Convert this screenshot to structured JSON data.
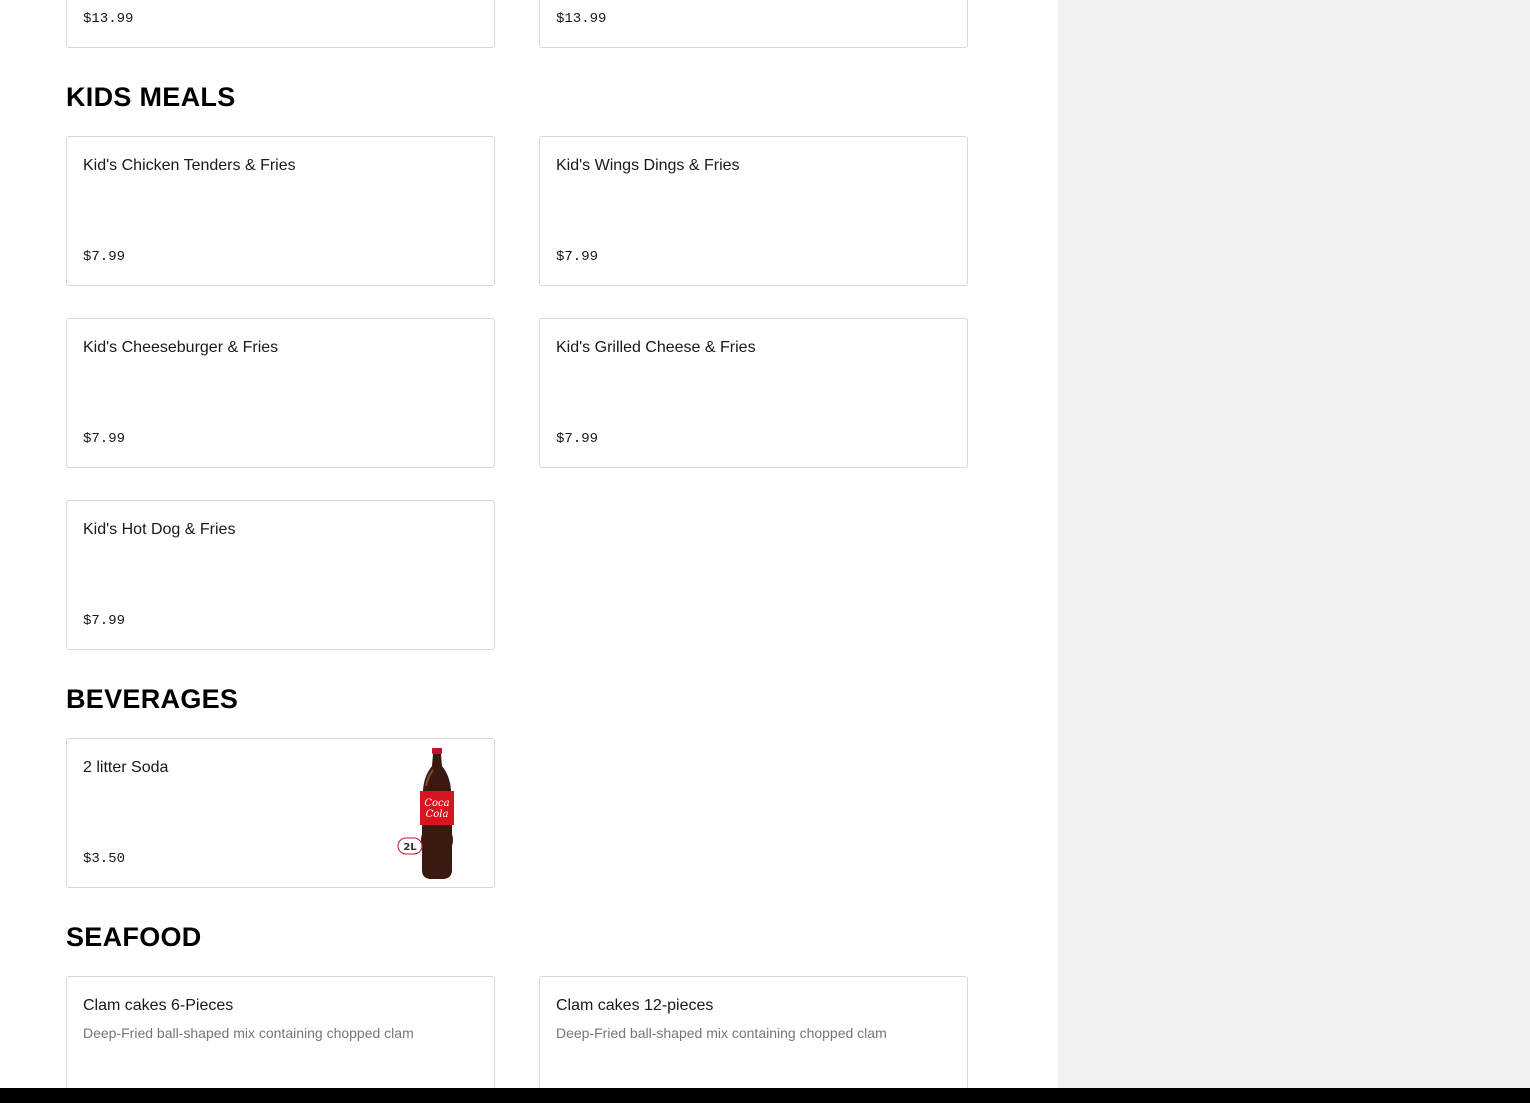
{
  "top_cards": [
    {
      "price": "$13.99"
    },
    {
      "price": "$13.99"
    }
  ],
  "sections": {
    "kids_meals": {
      "title": "KIDS MEALS",
      "items": [
        {
          "name": "Kid's Chicken Tenders & Fries",
          "price": "$7.99"
        },
        {
          "name": "Kid's Wings Dings & Fries",
          "price": "$7.99"
        },
        {
          "name": "Kid's Cheeseburger & Fries",
          "price": "$7.99"
        },
        {
          "name": "Kid's Grilled Cheese & Fries",
          "price": "$7.99"
        },
        {
          "name": "Kid's Hot Dog & Fries",
          "price": "$7.99"
        }
      ]
    },
    "beverages": {
      "title": "BEVERAGES",
      "items": [
        {
          "name": "2 litter Soda",
          "price": "$3.50",
          "image": "coca-cola-2l-bottle",
          "image_badge": "2L"
        }
      ]
    },
    "seafood": {
      "title": "SEAFOOD",
      "items": [
        {
          "name": "Clam cakes 6-Pieces",
          "description": "Deep-Fried ball-shaped mix containing chopped clam"
        },
        {
          "name": "Clam cakes 12-pieces",
          "description": "Deep-Fried ball-shaped mix containing chopped clam"
        }
      ]
    }
  },
  "colors": {
    "sidebar_bg": "#f3f2ef",
    "card_border": "#d8d8d8",
    "heading": "#000000",
    "description": "#767676",
    "bottom_bar": "#000000"
  }
}
